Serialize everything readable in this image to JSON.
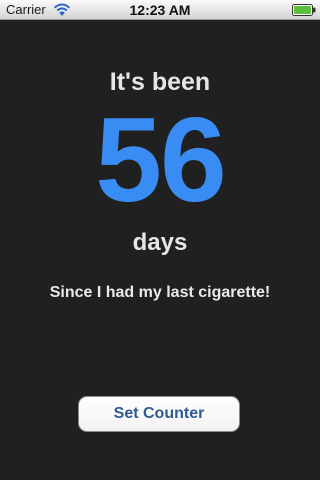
{
  "status_bar": {
    "carrier": "Carrier",
    "time": "12:23 AM",
    "wifi_icon": "wifi-icon",
    "battery_icon": "battery-full-icon"
  },
  "main": {
    "headline": "It's been",
    "count": "56",
    "unit": "days",
    "caption": "Since I had my last cigarette!",
    "set_counter_label": "Set Counter"
  },
  "colors": {
    "background": "#202020",
    "count": "#3a8cf5",
    "text": "#e6e6e6",
    "button_text": "#2f5a93"
  }
}
